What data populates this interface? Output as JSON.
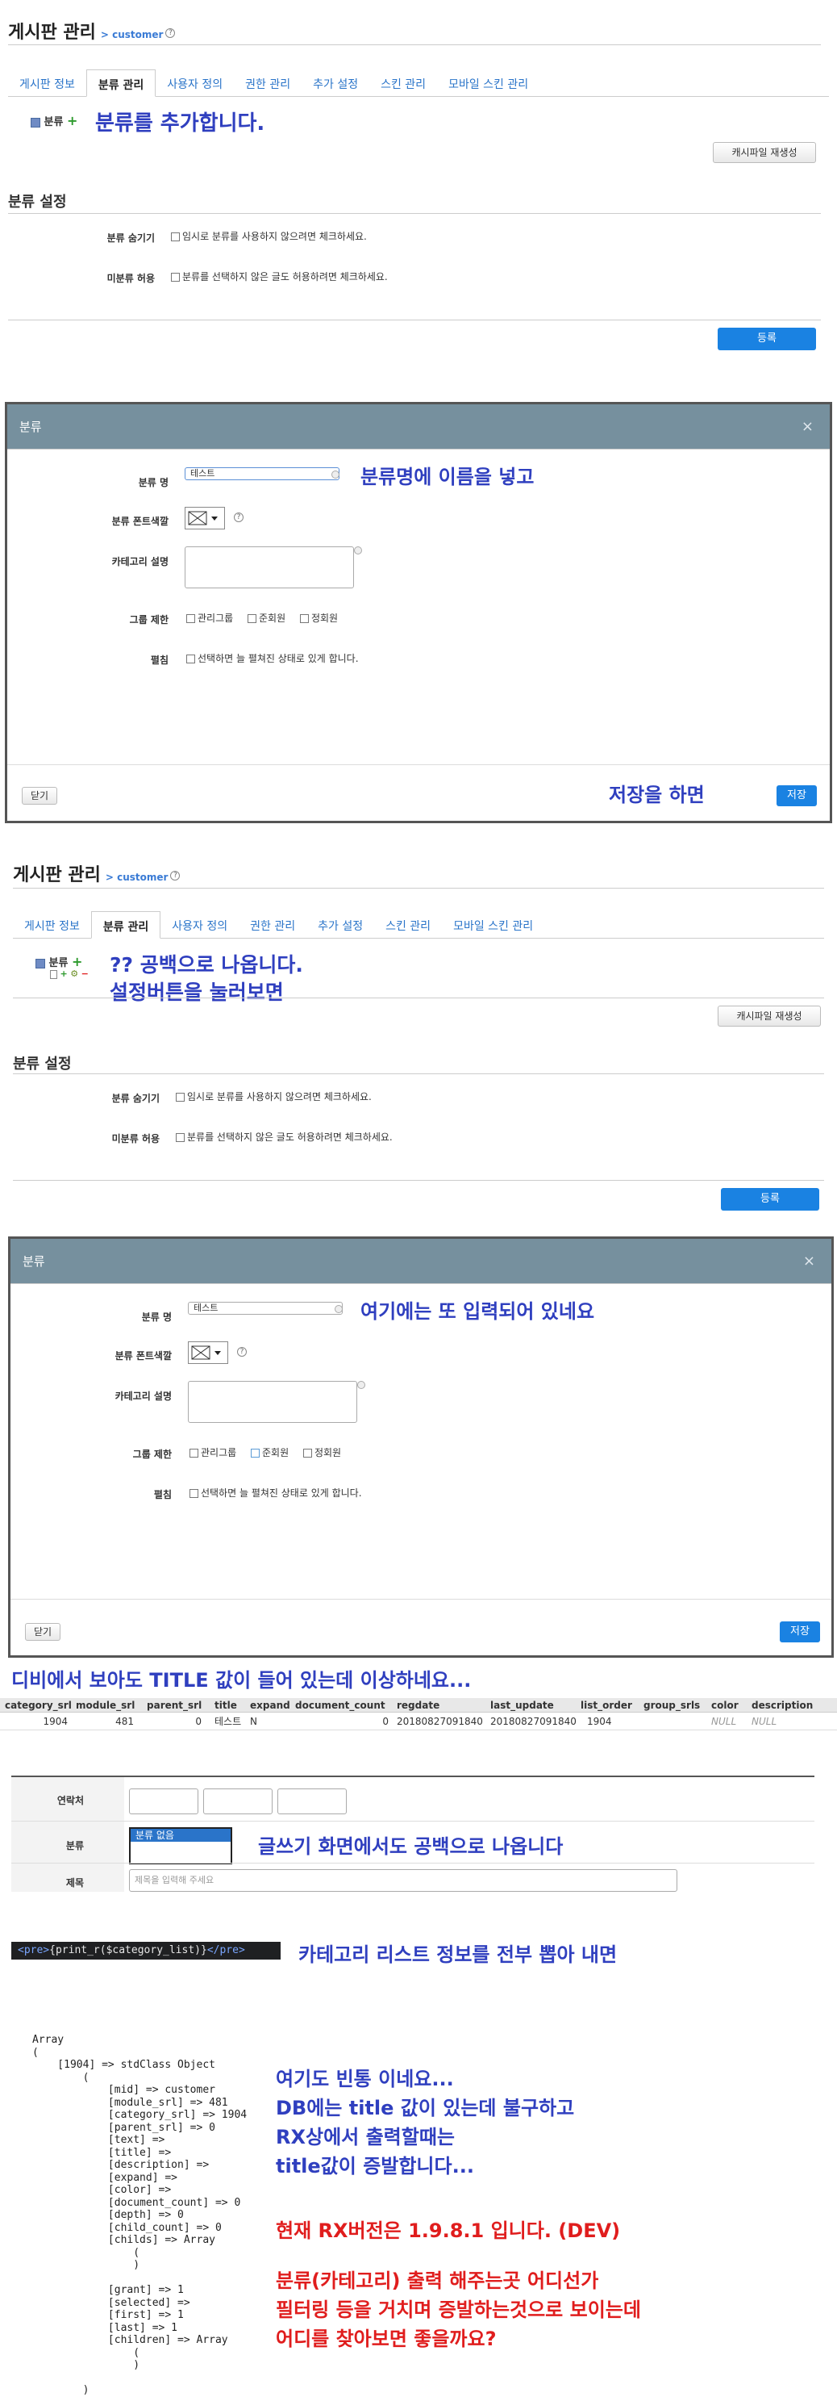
{
  "panel1": {
    "title": "게시판 관리",
    "crumb": "> customer",
    "help": "?",
    "tabs": [
      "게시판 정보",
      "분류 관리",
      "사용자 정의",
      "권한 관리",
      "추가 설정",
      "스킨 관리",
      "모바일 스킨 관리"
    ],
    "tree_label": "분류",
    "note": "분류를 추가합니다.",
    "cache_btn": "캐시파일 재생성",
    "section": "분류 설정",
    "hide_label": "분류 숨기기",
    "hide_text": "임시로 분류를 사용하지 않으려면 체크하세요.",
    "uncat_label": "미분류 허용",
    "uncat_text": "분류를 선택하지 않은 글도 허용하려면 체크하세요.",
    "submit": "등록"
  },
  "modal1": {
    "title": "분류",
    "close": "×",
    "name_label": "분류 명",
    "name_value": "테스트",
    "note1": "분류명에 이름을 넣고",
    "font_color_label": "분류 폰트색깔",
    "desc_label": "카테고리 설명",
    "group_label": "그룹 제한",
    "groups": [
      "관리그룹",
      "준회원",
      "정회원"
    ],
    "expand_label": "펼침",
    "expand_text": "선택하면 늘 펼쳐진 상태로 있게 합니다.",
    "close_btn": "닫기",
    "note2": "저장을 하면",
    "save_btn": "저장"
  },
  "panel2": {
    "title": "게시판 관리",
    "crumb": "> customer",
    "help": "?",
    "tabs": [
      "게시판 정보",
      "분류 관리",
      "사용자 정의",
      "권한 관리",
      "추가 설정",
      "스킨 관리",
      "모바일 스킨 관리"
    ],
    "tree_label": "분류",
    "note1": "?? 공백으로 나옵니다.",
    "note2": "설정버튼을 눌러보면",
    "cache_btn": "캐시파일 재생성",
    "section": "분류 설정",
    "hide_label": "분류 숨기기",
    "hide_text": "임시로 분류를 사용하지 않으려면 체크하세요.",
    "uncat_label": "미분류 허용",
    "uncat_text": "분류를 선택하지 않은 글도 허용하려면 체크하세요.",
    "submit": "등록"
  },
  "modal2": {
    "title": "분류",
    "close": "×",
    "name_label": "분류 명",
    "name_value": "테스트",
    "note1": "여기에는 또 입력되어 있네요",
    "font_color_label": "분류 폰트색깔",
    "desc_label": "카테고리 설명",
    "group_label": "그룹 제한",
    "groups": [
      "관리그룹",
      "준회원",
      "정회원"
    ],
    "expand_label": "펼침",
    "expand_text": "선택하면 늘 펼쳐진 상태로 있게 합니다.",
    "close_btn": "닫기",
    "save_btn": "저장"
  },
  "db": {
    "note": "디비에서 보아도 TITLE 값이 들어 있는데 이상하네요...",
    "headers": [
      "category_srl",
      "module_srl",
      "parent_srl",
      "title",
      "expand",
      "document_count",
      "regdate",
      "last_update",
      "list_order",
      "group_srls",
      "color",
      "description"
    ],
    "row": [
      "1904",
      "481",
      "0",
      "테스트",
      "N",
      "0",
      "20180827091840",
      "20180827091840",
      "1904",
      "",
      "NULL",
      "NULL"
    ]
  },
  "write": {
    "contact_label": "연락처",
    "category_label": "분류",
    "category_value": "분류 없음",
    "note": "글쓰기 화면에서도 공백으로 나옵니다",
    "title_label": "제목",
    "title_placeholder": "제목을 입력해 주세요"
  },
  "code": {
    "snippet_pre_open": "<pre>",
    "snippet_body": "{print_r($category_list)}",
    "snippet_pre_close": "</pre>",
    "note": "카테고리 리스트 정보를 전부 뽑아 내면"
  },
  "array": {
    "lines": [
      "Array",
      "(",
      "    [1904] => stdClass Object",
      "        (",
      "            [mid] => customer",
      "            [module_srl] => 481",
      "            [category_srl] => 1904",
      "            [parent_srl] => 0",
      "            [text] =>",
      "            [title] =>",
      "            [description] =>",
      "            [expand] =>",
      "            [color] =>",
      "            [document_count] => 0",
      "            [depth] => 0",
      "            [child_count] => 0",
      "            [childs] => Array",
      "                (",
      "                )",
      "",
      "            [grant] => 1",
      "            [selected] =>",
      "            [first] => 1",
      "            [last] => 1",
      "            [children] => Array",
      "                (",
      "                )",
      "",
      "        )"
    ],
    "note_blue": [
      "여기도 빈통 이네요...",
      "DB에는 title 값이 있는데 불구하고",
      "RX상에서 출력할때는",
      "title값이 증발합니다..."
    ],
    "note_red1": "현재 RX버전은 1.9.8.1 입니다. (DEV)",
    "note_red2": [
      "분류(카테고리) 출력 해주는곳 어디선가",
      "필터링 등을 거치며 증발하는것으로 보이는데",
      "어디를 찾아보면 좋을까요?"
    ]
  }
}
